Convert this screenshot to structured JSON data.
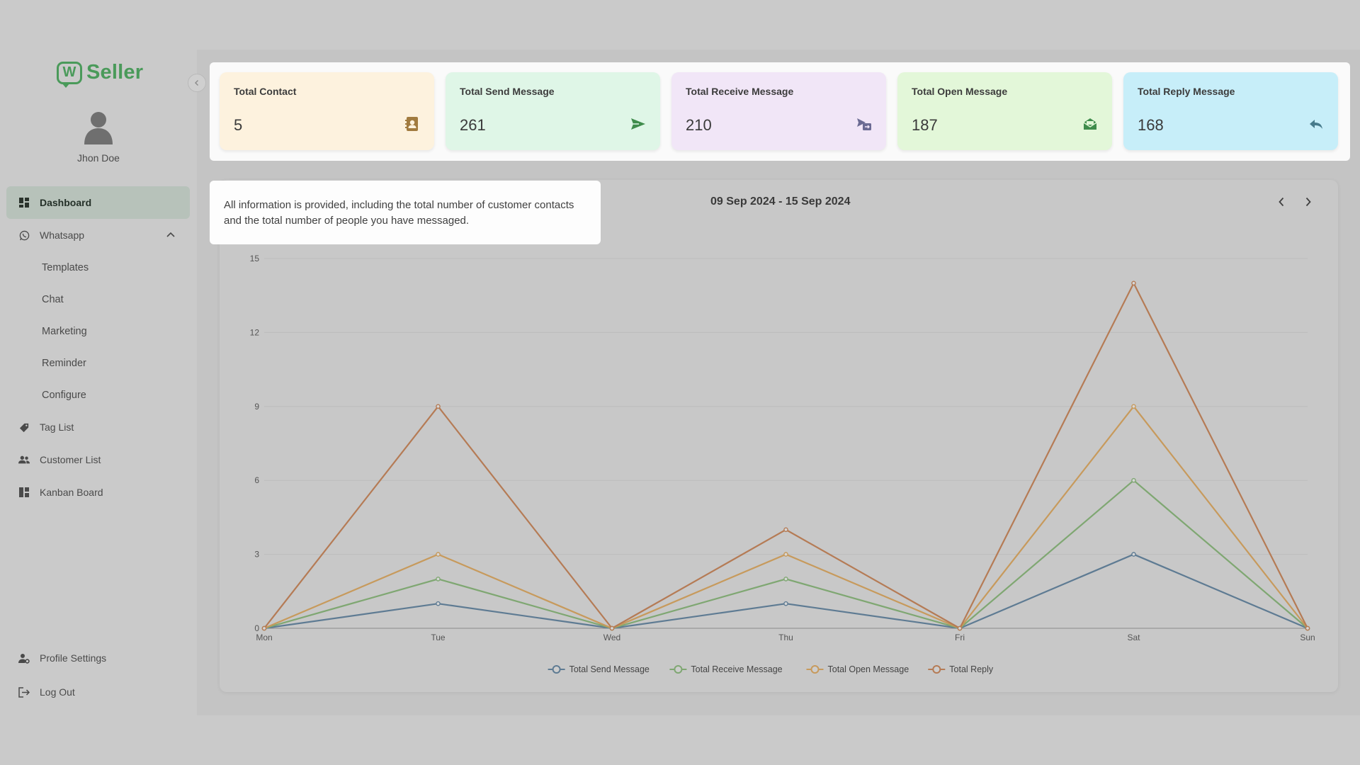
{
  "app": {
    "logo_letter": "W",
    "logo_text": "Seller"
  },
  "user": {
    "name": "Jhon Doe"
  },
  "sidebar": {
    "items": [
      {
        "label": "Dashboard",
        "icon": "grid-icon",
        "active": true
      },
      {
        "label": "Whatsapp",
        "icon": "whatsapp-icon",
        "expanded": true,
        "children": [
          "Templates",
          "Chat",
          "Marketing",
          "Reminder",
          "Configure"
        ]
      },
      {
        "label": "Tag List",
        "icon": "tag-icon"
      },
      {
        "label": "Customer List",
        "icon": "users-icon"
      },
      {
        "label": "Kanban Board",
        "icon": "kanban-icon"
      }
    ],
    "bottom": [
      {
        "label": "Profile Settings",
        "icon": "user-settings-icon"
      },
      {
        "label": "Log Out",
        "icon": "logout-icon"
      }
    ]
  },
  "stats": [
    {
      "label": "Total Contact",
      "value": "5",
      "bg": "#fdf2de",
      "icon": "contact-book-icon",
      "icon_color": "#a17b3f"
    },
    {
      "label": "Total Send Message",
      "value": "261",
      "bg": "#dff6e7",
      "icon": "send-icon",
      "icon_color": "#3f8c4c"
    },
    {
      "label": "Total Receive Message",
      "value": "210",
      "bg": "#f1e6f7",
      "icon": "receive-icon",
      "icon_color": "#6b6b93"
    },
    {
      "label": "Total Open Message",
      "value": "187",
      "bg": "#e3f7d9",
      "icon": "open-envelope-icon",
      "icon_color": "#3f8c4c"
    },
    {
      "label": "Total Reply Message",
      "value": "168",
      "bg": "#c7eef9",
      "icon": "reply-icon",
      "icon_color": "#477b8c"
    }
  ],
  "tooltip": {
    "text": "All information is provided, including the total number of customer contacts and the total number of people you have messaged."
  },
  "chart_header": {
    "date_range": "09 Sep 2024 - 15 Sep 2024",
    "prev": "‹",
    "next": "›"
  },
  "chart_data": {
    "type": "line",
    "categories": [
      "Mon",
      "Tue",
      "Wed",
      "Thu",
      "Fri",
      "Sat",
      "Sun"
    ],
    "ylim": [
      0,
      15
    ],
    "yticks": [
      0,
      3,
      6,
      9,
      12,
      15
    ],
    "grid": true,
    "legend_position": "bottom-center",
    "series": [
      {
        "name": "Total Send Message",
        "color": "#5e7b93",
        "values": [
          0,
          1,
          0,
          1,
          0,
          3,
          0
        ]
      },
      {
        "name": "Total Receive Message",
        "color": "#7fa772",
        "values": [
          0,
          2,
          0,
          2,
          0,
          6,
          0
        ]
      },
      {
        "name": "Total Open Message",
        "color": "#c79a5c",
        "values": [
          0,
          3,
          0,
          3,
          0,
          9,
          0
        ]
      },
      {
        "name": "Total Reply",
        "color": "#b57b55",
        "values": [
          0,
          9,
          0,
          4,
          0,
          14,
          0
        ]
      }
    ]
  }
}
